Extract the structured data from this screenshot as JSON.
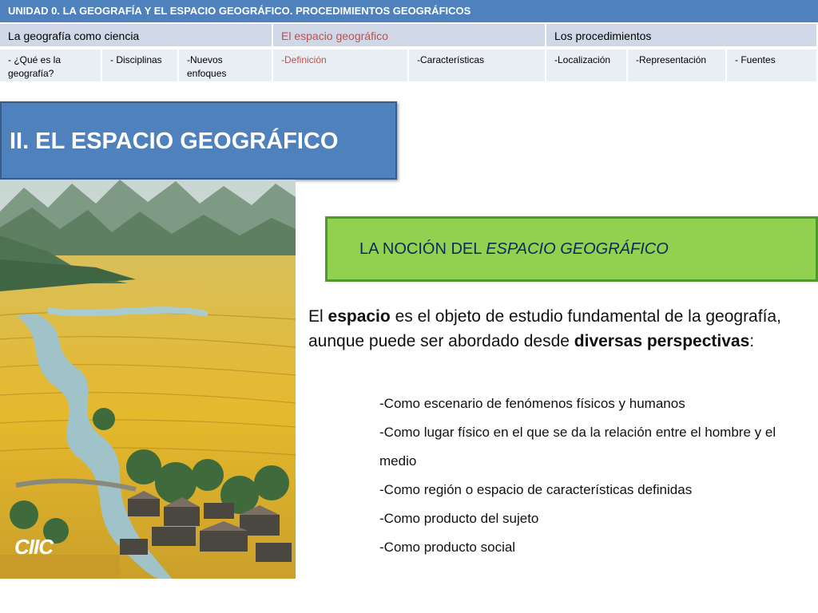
{
  "header": {
    "title": "UNIDAD 0.  LA GEOGRAFÍA Y EL ESPACIO GEOGRÁFICO. PROCEDIMIENTOS GEOGRÁFICOS"
  },
  "sections": [
    "La geografía como ciencia",
    "El espacio geográfico",
    "Los procedimientos"
  ],
  "subsections": [
    "-  ¿Qué es la geografía?",
    "- Disciplinas",
    "-Nuevos enfoques",
    "-Definición",
    "-Características",
    "-Localización",
    "-Representación",
    "- Fuentes"
  ],
  "colors": {
    "header_blue": "#4f81bd",
    "active_red": "#c0504d",
    "green_box": "#92d050",
    "green_border": "#4e9a2f"
  },
  "slide": {
    "title": "II. EL ESPACIO GEOGRÁFICO",
    "subtitle_pre": "LA NOCIÓN DEL ",
    "subtitle_em": "ESPACIO GEOGRÁFICO",
    "logo_text": "CIIC",
    "intro": {
      "p1": "El ",
      "b1": "espacio",
      "p2": " es el objeto de estudio fundamental de la geografía, aunque puede ser abordado desde ",
      "b2": "diversas perspectivas",
      "p3": ":"
    },
    "items": [
      "-Como escenario de fenómenos físicos y humanos",
      "-Como lugar físico en el que se da la relación entre el hombre y el medio",
      "-Como región o espacio de características definidas",
      "-Como producto del sujeto",
      "-Como producto social"
    ]
  }
}
